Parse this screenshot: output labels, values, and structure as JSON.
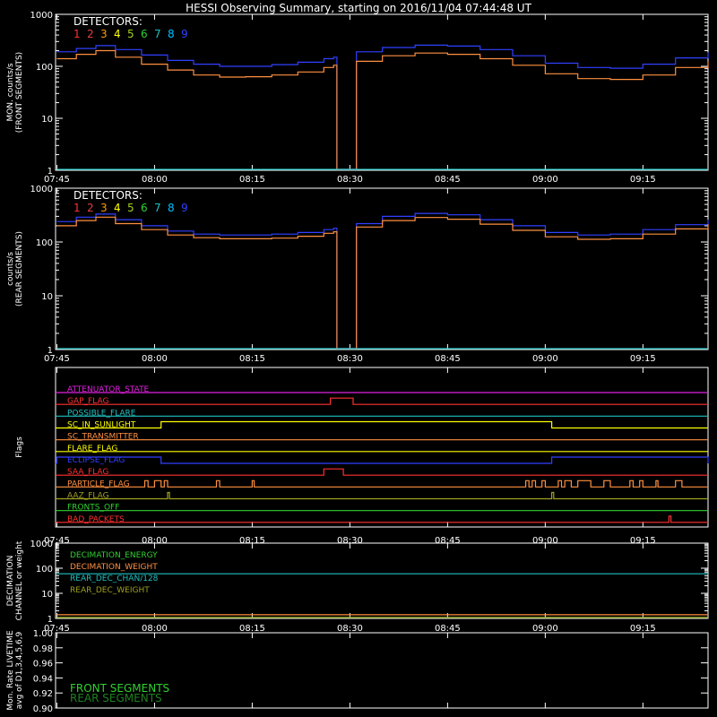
{
  "title": "HESSI Observing Summary, starting on 2016/11/04 07:44:48 UT",
  "time_ticks": [
    "07:45",
    "08:00",
    "08:15",
    "08:30",
    "08:45",
    "09:00",
    "09:15"
  ],
  "detectors": {
    "label": "DETECTORS:",
    "numbers": [
      "1",
      "2",
      "3",
      "4",
      "5",
      "6",
      "7",
      "8",
      "9"
    ],
    "colors": [
      "#ff3030",
      "#e04040",
      "#ff9900",
      "#ffff00",
      "#a0d020",
      "#30d030",
      "#20c0c0",
      "#00c0ff",
      "#3040ff"
    ]
  },
  "chart_data": [
    {
      "type": "line",
      "panel": "front",
      "ylabel": "MON. counts/s",
      "ylabel2": "(FRONT SEGMENTS)",
      "ylim": [
        1,
        1000
      ],
      "yscale": "log",
      "yticks": [
        "1",
        "10",
        "100",
        "1000"
      ],
      "x_unit": "UT",
      "series": [
        {
          "color": "#3040ff",
          "x": [
            "07:45",
            "07:48",
            "07:51",
            "07:54",
            "07:58",
            "08:02",
            "08:06",
            "08:10",
            "08:14",
            "08:18",
            "08:22",
            "08:26",
            "08:27.5",
            "08:28",
            "08:30",
            "08:31",
            "08:35",
            "08:40",
            "08:45",
            "08:50",
            "08:55",
            "09:00",
            "09:05",
            "09:10",
            "09:15",
            "09:20",
            "09:25"
          ],
          "values": [
            190,
            220,
            250,
            210,
            165,
            130,
            110,
            100,
            100,
            108,
            120,
            140,
            150,
            1,
            1,
            190,
            230,
            255,
            245,
            210,
            160,
            115,
            95,
            92,
            110,
            145,
            185
          ]
        },
        {
          "color": "#ff9040",
          "x": [
            "07:45",
            "07:48",
            "07:51",
            "07:54",
            "07:58",
            "08:02",
            "08:06",
            "08:10",
            "08:14",
            "08:18",
            "08:22",
            "08:26",
            "08:27.5",
            "08:28",
            "08:30",
            "08:31",
            "08:35",
            "08:40",
            "08:45",
            "08:50",
            "08:55",
            "09:00",
            "09:05",
            "09:10",
            "09:15",
            "09:20",
            "09:25"
          ],
          "values": [
            140,
            170,
            200,
            150,
            110,
            85,
            68,
            62,
            63,
            68,
            78,
            95,
            105,
            1,
            1,
            125,
            160,
            180,
            170,
            140,
            105,
            72,
            58,
            56,
            68,
            95,
            125
          ]
        },
        {
          "color": "#20c0c0",
          "x": [
            "07:45",
            "09:25"
          ],
          "values": [
            1,
            1
          ]
        }
      ]
    },
    {
      "type": "line",
      "panel": "rear",
      "ylabel": "counts/s",
      "ylabel2": "(REAR SEGMENTS)",
      "ylim": [
        1,
        1000
      ],
      "yscale": "log",
      "yticks": [
        "1",
        "10",
        "100",
        "1000"
      ],
      "series": [
        {
          "color": "#3040ff",
          "x": [
            "07:45",
            "07:48",
            "07:51",
            "07:54",
            "07:58",
            "08:02",
            "08:06",
            "08:10",
            "08:14",
            "08:18",
            "08:22",
            "08:26",
            "08:27.5",
            "08:28",
            "08:30",
            "08:31",
            "08:35",
            "08:40",
            "08:45",
            "08:50",
            "08:55",
            "09:00",
            "09:05",
            "09:10",
            "09:15",
            "09:20",
            "09:25"
          ],
          "values": [
            240,
            290,
            330,
            260,
            200,
            160,
            140,
            135,
            135,
            140,
            150,
            170,
            180,
            1,
            1,
            220,
            300,
            340,
            320,
            260,
            200,
            150,
            135,
            140,
            170,
            210,
            260
          ]
        },
        {
          "color": "#ff9040",
          "x": [
            "07:45",
            "07:48",
            "07:51",
            "07:54",
            "07:58",
            "08:02",
            "08:06",
            "08:10",
            "08:14",
            "08:18",
            "08:22",
            "08:26",
            "08:27.5",
            "08:28",
            "08:30",
            "08:31",
            "08:35",
            "08:40",
            "08:45",
            "08:50",
            "08:55",
            "09:00",
            "09:05",
            "09:10",
            "09:15",
            "09:20",
            "09:25"
          ],
          "values": [
            200,
            250,
            290,
            220,
            170,
            135,
            120,
            115,
            115,
            118,
            128,
            145,
            155,
            1,
            1,
            190,
            250,
            285,
            265,
            215,
            165,
            125,
            112,
            115,
            140,
            175,
            215
          ]
        },
        {
          "color": "#20c0c0",
          "x": [
            "07:45",
            "09:25"
          ],
          "values": [
            1,
            1
          ]
        }
      ]
    },
    {
      "type": "line",
      "panel": "flags",
      "ylabel": "Flags",
      "flags": [
        {
          "name": "ATTENUATOR_STATE",
          "color": "#e020e0"
        },
        {
          "name": "GAP_FLAG",
          "color": "#ff3030",
          "pulses": [
            [
              "08:27",
              "08:30.5"
            ]
          ]
        },
        {
          "name": "POSSIBLE_FLARE",
          "color": "#20c0c0"
        },
        {
          "name": "SC_IN_SUNLIGHT",
          "color": "#ffff00",
          "pulses": [
            [
              "08:01",
              "09:01"
            ]
          ]
        },
        {
          "name": "SC_TRANSMITTER",
          "color": "#ff9040"
        },
        {
          "name": "FLARE_FLAG",
          "color": "#ffff00"
        },
        {
          "name": "ECLIPSE_FLAG",
          "color": "#3040ff",
          "pulses": [
            [
              "07:45",
              "08:01"
            ],
            [
              "09:01",
              "09:25"
            ]
          ]
        },
        {
          "name": "SAA_FLAG",
          "color": "#ff3030",
          "pulses": [
            [
              "08:26",
              "08:29"
            ]
          ]
        },
        {
          "name": "PARTICLE_FLAG",
          "color": "#ff9040",
          "pulses": [
            [
              "07:58.5",
              "07:59"
            ],
            [
              "08:00",
              "08:01"
            ],
            [
              "08:01.5",
              "08:02"
            ],
            [
              "08:09.5",
              "08:10"
            ],
            [
              "08:15",
              "08:15.3"
            ],
            [
              "08:57",
              "08:57.5"
            ],
            [
              "08:58",
              "08:58.5"
            ],
            [
              "08:59.5",
              "09:00"
            ],
            [
              "09:02",
              "09:02.5"
            ],
            [
              "09:03",
              "09:04"
            ],
            [
              "09:05",
              "09:07"
            ],
            [
              "09:09",
              "09:10"
            ],
            [
              "09:13",
              "09:13.5"
            ],
            [
              "09:14.5",
              "09:15"
            ],
            [
              "09:17",
              "09:17.3"
            ],
            [
              "09:20",
              "09:21"
            ]
          ]
        },
        {
          "name": "AAZ_FLAG",
          "color": "#a0a020",
          "pulses": [
            [
              "08:02",
              "08:02.3"
            ],
            [
              "09:01",
              "09:01.3"
            ]
          ]
        },
        {
          "name": "FRONTS_OFF",
          "color": "#30d030"
        },
        {
          "name": "BAD_PACKETS",
          "color": "#ff3030",
          "pulses": [
            [
              "09:19",
              "09:19.3"
            ]
          ]
        }
      ]
    },
    {
      "type": "line",
      "panel": "decimation",
      "ylabel": "DECIMATION",
      "ylabel2": "CHANNEL or weight",
      "ylim": [
        1,
        1000
      ],
      "yscale": "log",
      "yticks": [
        "1",
        "10",
        "100",
        "1000"
      ],
      "series": [
        {
          "name": "DECIMATION_ENERGY",
          "color": "#30d030",
          "x": [
            "07:45",
            "09:25"
          ],
          "values": [
            1,
            1
          ]
        },
        {
          "name": "DECIMATION_WEIGHT",
          "color": "#ff9040",
          "x": [
            "07:45",
            "09:25"
          ],
          "values": [
            1.4,
            1.4
          ]
        },
        {
          "name": "REAR_DEC_CHAN/128",
          "color": "#20c0c0",
          "x": [
            "07:45",
            "09:25"
          ],
          "values": [
            60,
            60
          ]
        },
        {
          "name": "REAR_DEC_WEIGHT",
          "color": "#a0a020",
          "x": [
            "07:45",
            "09:25"
          ],
          "values": [
            1,
            1
          ]
        }
      ]
    },
    {
      "type": "line",
      "panel": "livetime",
      "ylabel": "Mon. Rate LIVETIME",
      "ylabel2": "avg of D1,3,4,5,6,9",
      "ylim": [
        0.9,
        1.0
      ],
      "yticks": [
        "0.90",
        "0.92",
        "0.94",
        "0.96",
        "0.98",
        "1.00"
      ],
      "series": [
        {
          "name": "FRONT SEGMENTS",
          "color": "#30d030",
          "x": [],
          "values": []
        },
        {
          "name": "REAR SEGMENTS",
          "color": "#208020",
          "x": [],
          "values": []
        }
      ]
    }
  ]
}
